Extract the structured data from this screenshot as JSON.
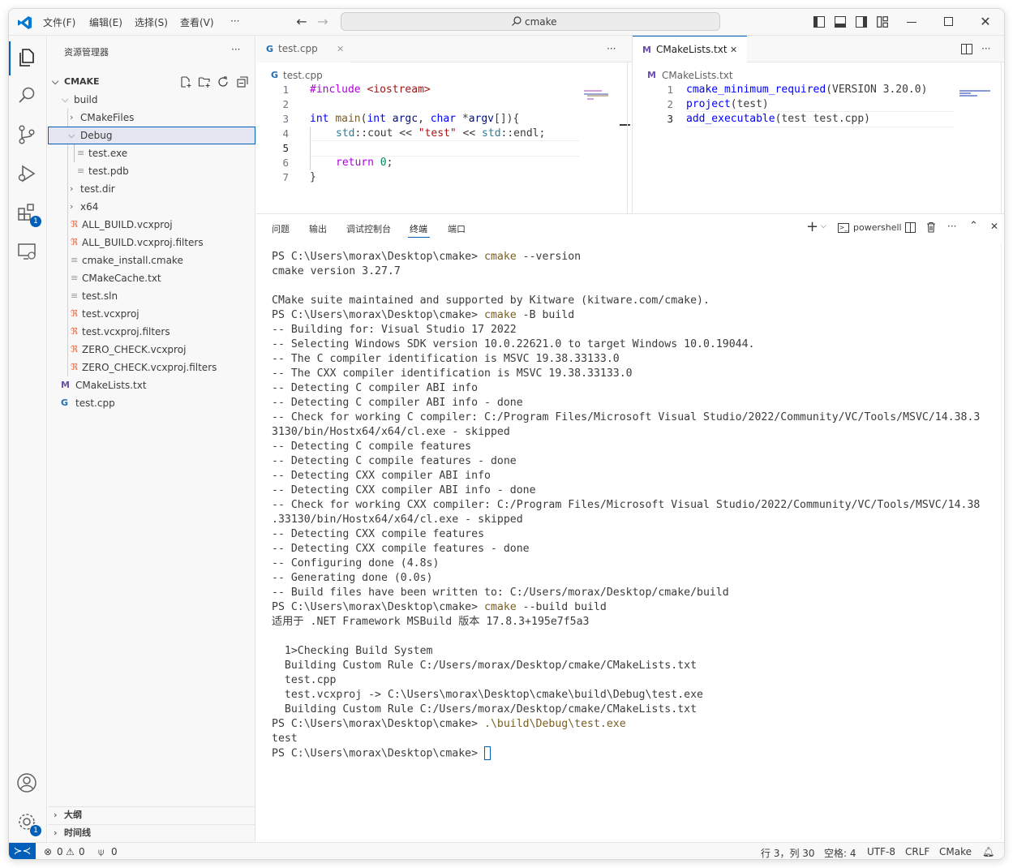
{
  "titlebar": {
    "menus": [
      "文件(F)",
      "编辑(E)",
      "选择(S)",
      "查看(V)",
      "···"
    ],
    "search_text": "cmake"
  },
  "activity": {
    "extensions_badge": "1",
    "settings_badge": "1"
  },
  "sidebar": {
    "title": "资源管理器",
    "more": "···",
    "section": "CMAKE",
    "items": [
      {
        "label": "build"
      },
      {
        "label": "CMakeFiles"
      },
      {
        "label": "Debug"
      },
      {
        "label": "test.exe"
      },
      {
        "label": "test.pdb"
      },
      {
        "label": "test.dir"
      },
      {
        "label": "x64"
      },
      {
        "label": "ALL_BUILD.vcxproj"
      },
      {
        "label": "ALL_BUILD.vcxproj.filters"
      },
      {
        "label": "cmake_install.cmake"
      },
      {
        "label": "CMakeCache.txt"
      },
      {
        "label": "test.sln"
      },
      {
        "label": "test.vcxproj"
      },
      {
        "label": "test.vcxproj.filters"
      },
      {
        "label": "ZERO_CHECK.vcxproj"
      },
      {
        "label": "ZERO_CHECK.vcxproj.filters"
      },
      {
        "label": "CMakeLists.txt"
      },
      {
        "label": "test.cpp"
      }
    ],
    "outline": "大纲",
    "timeline": "时间线"
  },
  "editor_left": {
    "tab": "test.cpp",
    "breadcrumb": "test.cpp",
    "more": "···",
    "lines": [
      "1",
      "2",
      "3",
      "4",
      "5",
      "6",
      "7"
    ],
    "code": {
      "l1_pp": "#include",
      "l1_str": "<iostream>",
      "l3_kw1": "int",
      "l3_fn": "main",
      "l3_p1": "(",
      "l3_kw2": "int",
      "l3_var1": "argc",
      "l3_p2": ", ",
      "l3_kw3": "char",
      "l3_p3": " *",
      "l3_var2": "argv",
      "l3_p4": "[]){",
      "l4_ty": "std",
      "l4_p1": "::cout << ",
      "l4_str": "\"test\"",
      "l4_p2": " << ",
      "l4_ty2": "std",
      "l4_p3": "::endl;",
      "l6_kw": "return",
      "l6_num": "0",
      "l6_p": ";",
      "l7": "}"
    }
  },
  "editor_right": {
    "tab": "CMakeLists.txt",
    "breadcrumb": "CMakeLists.txt",
    "more": "···",
    "lines": [
      "1",
      "2",
      "3"
    ],
    "code": {
      "l1_fn": "cmake_minimum_required",
      "l1_rest": "(VERSION 3.20.0)",
      "l2_fn": "project",
      "l2_rest": "(test)",
      "l3_fn": "add_executable",
      "l3_rest": "(test test.cpp)"
    }
  },
  "panel": {
    "tabs": [
      "问题",
      "输出",
      "调试控制台",
      "终端",
      "端口"
    ],
    "shell": "powershell",
    "more": "···",
    "terminal": [
      {
        "p": "PS C:\\Users\\morax\\Desktop\\cmake> ",
        "c": "cmake",
        "a": " --version"
      },
      {
        "p": "cmake version 3.27.7",
        "c": "",
        "a": ""
      },
      {
        "p": "",
        "c": "",
        "a": ""
      },
      {
        "p": "CMake suite maintained and supported by Kitware (kitware.com/cmake).",
        "c": "",
        "a": ""
      },
      {
        "p": "PS C:\\Users\\morax\\Desktop\\cmake> ",
        "c": "cmake",
        "a": " -B build"
      },
      {
        "p": "-- Building for: Visual Studio 17 2022",
        "c": "",
        "a": ""
      },
      {
        "p": "-- Selecting Windows SDK version 10.0.22621.0 to target Windows 10.0.19044.",
        "c": "",
        "a": ""
      },
      {
        "p": "-- The C compiler identification is MSVC 19.38.33133.0",
        "c": "",
        "a": ""
      },
      {
        "p": "-- The CXX compiler identification is MSVC 19.38.33133.0",
        "c": "",
        "a": ""
      },
      {
        "p": "-- Detecting C compiler ABI info",
        "c": "",
        "a": ""
      },
      {
        "p": "-- Detecting C compiler ABI info - done",
        "c": "",
        "a": ""
      },
      {
        "p": "-- Check for working C compiler: C:/Program Files/Microsoft Visual Studio/2022/Community/VC/Tools/MSVC/14.38.3",
        "c": "",
        "a": ""
      },
      {
        "p": "3130/bin/Hostx64/x64/cl.exe - skipped",
        "c": "",
        "a": ""
      },
      {
        "p": "-- Detecting C compile features",
        "c": "",
        "a": ""
      },
      {
        "p": "-- Detecting C compile features - done",
        "c": "",
        "a": ""
      },
      {
        "p": "-- Detecting CXX compiler ABI info",
        "c": "",
        "a": ""
      },
      {
        "p": "-- Detecting CXX compiler ABI info - done",
        "c": "",
        "a": ""
      },
      {
        "p": "-- Check for working CXX compiler: C:/Program Files/Microsoft Visual Studio/2022/Community/VC/Tools/MSVC/14.38",
        "c": "",
        "a": ""
      },
      {
        "p": ".33130/bin/Hostx64/x64/cl.exe - skipped",
        "c": "",
        "a": ""
      },
      {
        "p": "-- Detecting CXX compile features",
        "c": "",
        "a": ""
      },
      {
        "p": "-- Detecting CXX compile features - done",
        "c": "",
        "a": ""
      },
      {
        "p": "-- Configuring done (4.8s)",
        "c": "",
        "a": ""
      },
      {
        "p": "-- Generating done (0.0s)",
        "c": "",
        "a": ""
      },
      {
        "p": "-- Build files have been written to: C:/Users/morax/Desktop/cmake/build",
        "c": "",
        "a": ""
      },
      {
        "p": "PS C:\\Users\\morax\\Desktop\\cmake> ",
        "c": "cmake",
        "a": " --build build"
      },
      {
        "p": "适用于 .NET Framework MSBuild 版本 17.8.3+195e7f5a3",
        "c": "",
        "a": ""
      },
      {
        "p": "",
        "c": "",
        "a": ""
      },
      {
        "p": "  1>Checking Build System",
        "c": "",
        "a": ""
      },
      {
        "p": "  Building Custom Rule C:/Users/morax/Desktop/cmake/CMakeLists.txt",
        "c": "",
        "a": ""
      },
      {
        "p": "  test.cpp",
        "c": "",
        "a": ""
      },
      {
        "p": "  test.vcxproj -> C:\\Users\\morax\\Desktop\\cmake\\build\\Debug\\test.exe",
        "c": "",
        "a": ""
      },
      {
        "p": "  Building Custom Rule C:/Users/morax/Desktop/cmake/CMakeLists.txt",
        "c": "",
        "a": ""
      },
      {
        "p": "PS C:\\Users\\morax\\Desktop\\cmake> ",
        "c": ".\\build\\Debug\\test.exe",
        "a": ""
      },
      {
        "p": "test",
        "c": "",
        "a": ""
      },
      {
        "p": "PS C:\\Users\\morax\\Desktop\\cmake> ",
        "c": "",
        "a": ""
      }
    ]
  },
  "statusbar": {
    "errors": "0",
    "warnings": "0",
    "ports": "0",
    "position": "行 3，列 30",
    "spaces": "空格: 4",
    "encoding": "UTF-8",
    "eol": "CRLF",
    "language": "CMake"
  },
  "colors": {
    "accent": "#005fb8",
    "cmake_icon": "#6c4fa8",
    "cpp_icon": "#1e6fb3",
    "xml_icon": "#e8623a"
  }
}
